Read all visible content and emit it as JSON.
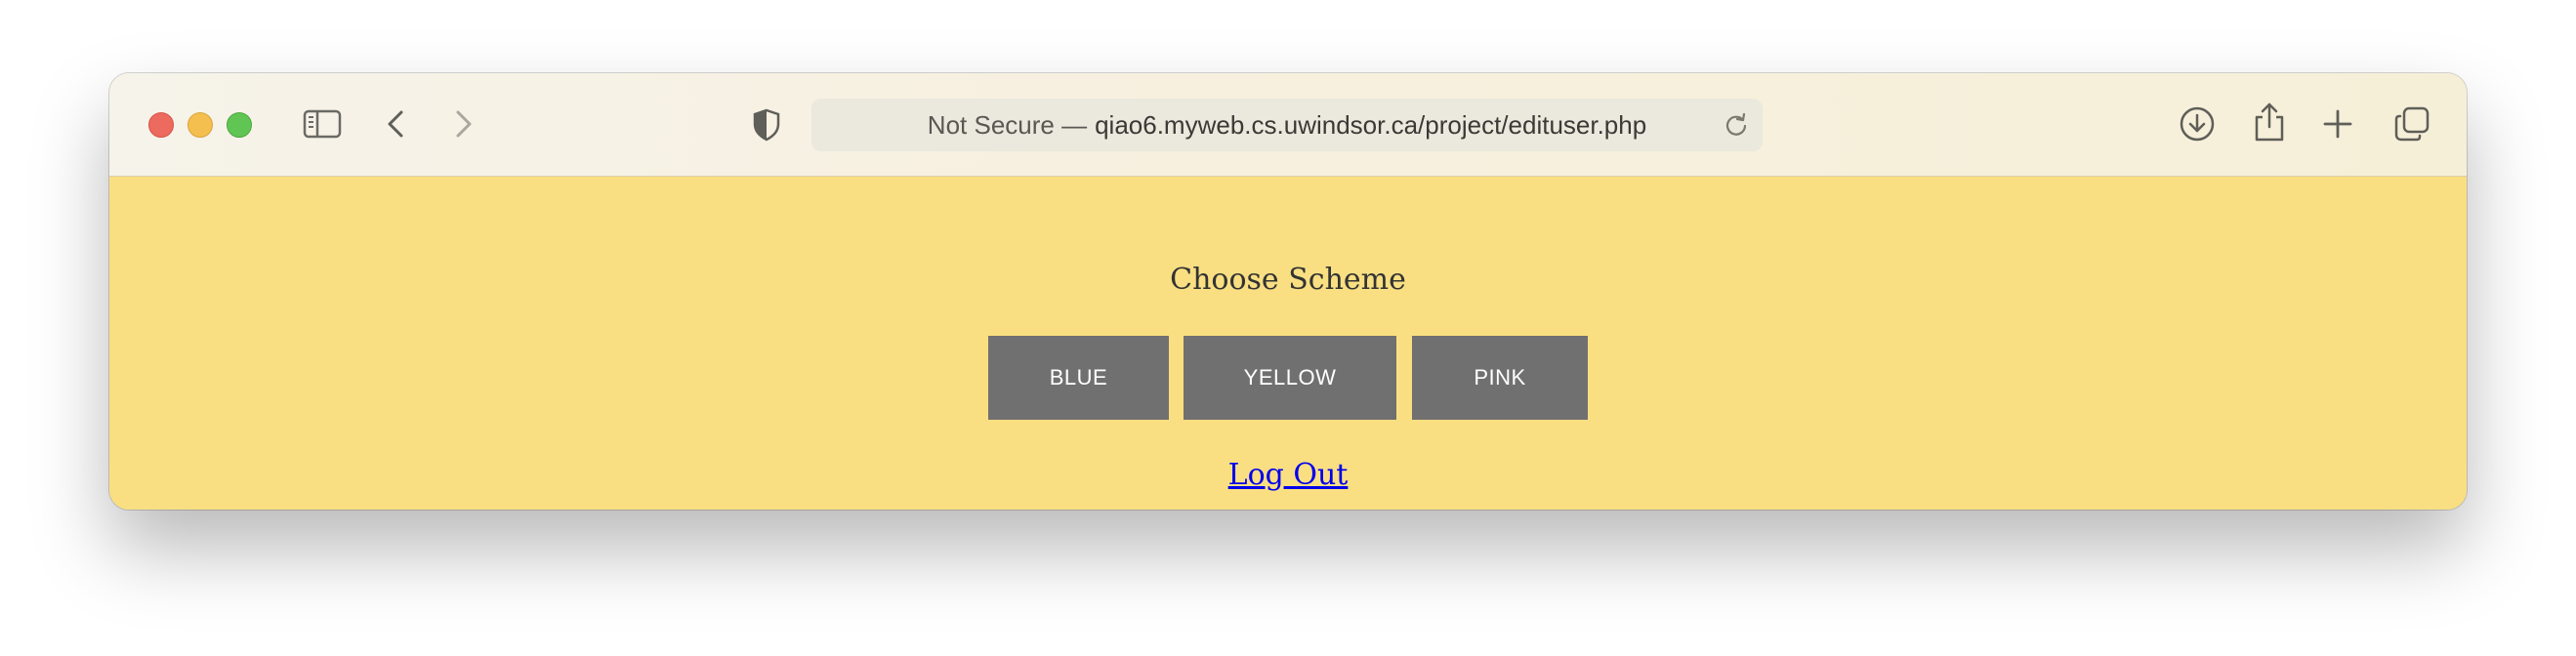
{
  "browser": {
    "address_prefix": "Not Secure —",
    "address_domain": "qiao6.myweb.cs.uwindsor.ca/project/edituser.php",
    "icons": {
      "sidebar": "sidebar-icon",
      "back": "chevron-left-icon",
      "forward": "chevron-right-icon",
      "security": "shield-icon",
      "reload": "reload-icon",
      "download": "download-icon",
      "share": "share-icon",
      "new_tab": "plus-icon",
      "tabs": "tabs-overview-icon"
    }
  },
  "page": {
    "heading": "Choose Scheme",
    "buttons": {
      "blue": "BLUE",
      "yellow": "YELLOW",
      "pink": "PINK"
    },
    "logout": "Log Out",
    "colors": {
      "background": "#f9df82",
      "button": "#707070",
      "link": "#0000ee"
    }
  }
}
